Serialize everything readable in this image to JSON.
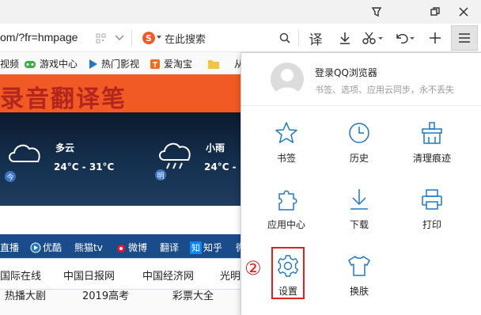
{
  "titlebar": {
    "buttons": [
      "menu-toggle",
      "restore",
      "close"
    ]
  },
  "addressbar": {
    "url": "om/?fr=hmpage",
    "search_placeholder": "在此搜索",
    "translate_label": "译"
  },
  "bookmarks": [
    {
      "label": "视频",
      "icon": "video-icon"
    },
    {
      "label": "游戏中心",
      "icon": "game-icon"
    },
    {
      "label": "热门影视",
      "icon": "play-icon"
    },
    {
      "label": "爱淘宝",
      "icon": "taobao-icon"
    },
    {
      "label": "从",
      "icon": "folder-icon"
    }
  ],
  "page": {
    "banner_text": "录音翻译笔",
    "weather": [
      {
        "cond": "多云",
        "temp": "24°C - 31°C",
        "badge": "今"
      },
      {
        "cond": "小雨",
        "temp": "24°C - ",
        "badge": "明"
      }
    ],
    "sitebar1": [
      "直播",
      "优酷",
      "熊猫tv",
      "微博",
      "翻译",
      "知乎",
      "微"
    ],
    "sitebar1_logo": "知",
    "sitebar2": [
      "国际在线",
      "中国日报网",
      "中国经济网",
      "光明"
    ],
    "sitebar3": [
      "热播大剧",
      "2019高考",
      "彩票大全"
    ]
  },
  "menu": {
    "login_title": "登录QQ浏览器",
    "login_subtitle": "书签、选项、应用云同步，永不丢失",
    "items": [
      {
        "label": "书签",
        "icon": "star-icon"
      },
      {
        "label": "历史",
        "icon": "clock-icon"
      },
      {
        "label": "清理痕迹",
        "icon": "broom-icon"
      },
      {
        "label": "应用中心",
        "icon": "puzzle-icon"
      },
      {
        "label": "下载",
        "icon": "download-icon"
      },
      {
        "label": "打印",
        "icon": "printer-icon"
      },
      {
        "label": "设置",
        "icon": "gear-icon"
      },
      {
        "label": "换肤",
        "icon": "shirt-icon"
      }
    ],
    "annotation": "②"
  },
  "colors": {
    "accent": "#1f78c1",
    "highlight": "#e02020",
    "banner": "#f15a24"
  }
}
